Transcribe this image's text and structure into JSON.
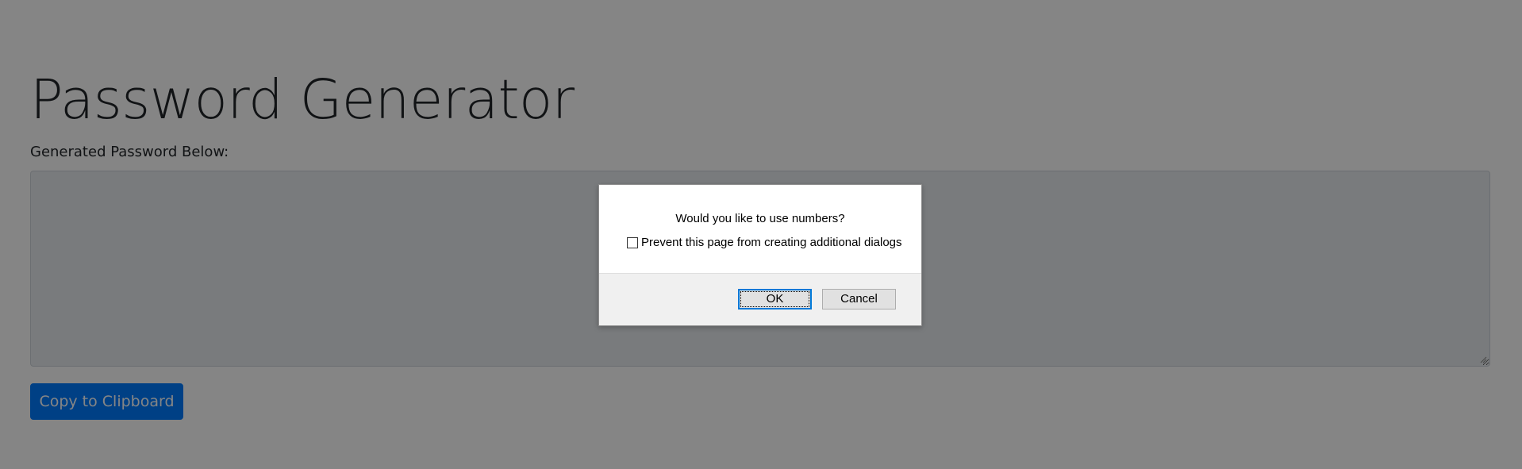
{
  "page": {
    "title": "Password Generator",
    "password_label": "Generated Password Below:",
    "password_value": "",
    "copy_button_label": "Copy to Clipboard"
  },
  "dialog": {
    "message": "Would you like to use numbers?",
    "checkbox_label": "Prevent this page from creating additional dialogs",
    "checkbox_checked": false,
    "ok_label": "OK",
    "cancel_label": "Cancel"
  },
  "colors": {
    "primary_button": "#007bff",
    "textarea_bg": "#e9ecef",
    "overlay": "rgba(0,0,0,0.48)",
    "dialog_focus": "#0078d7"
  }
}
